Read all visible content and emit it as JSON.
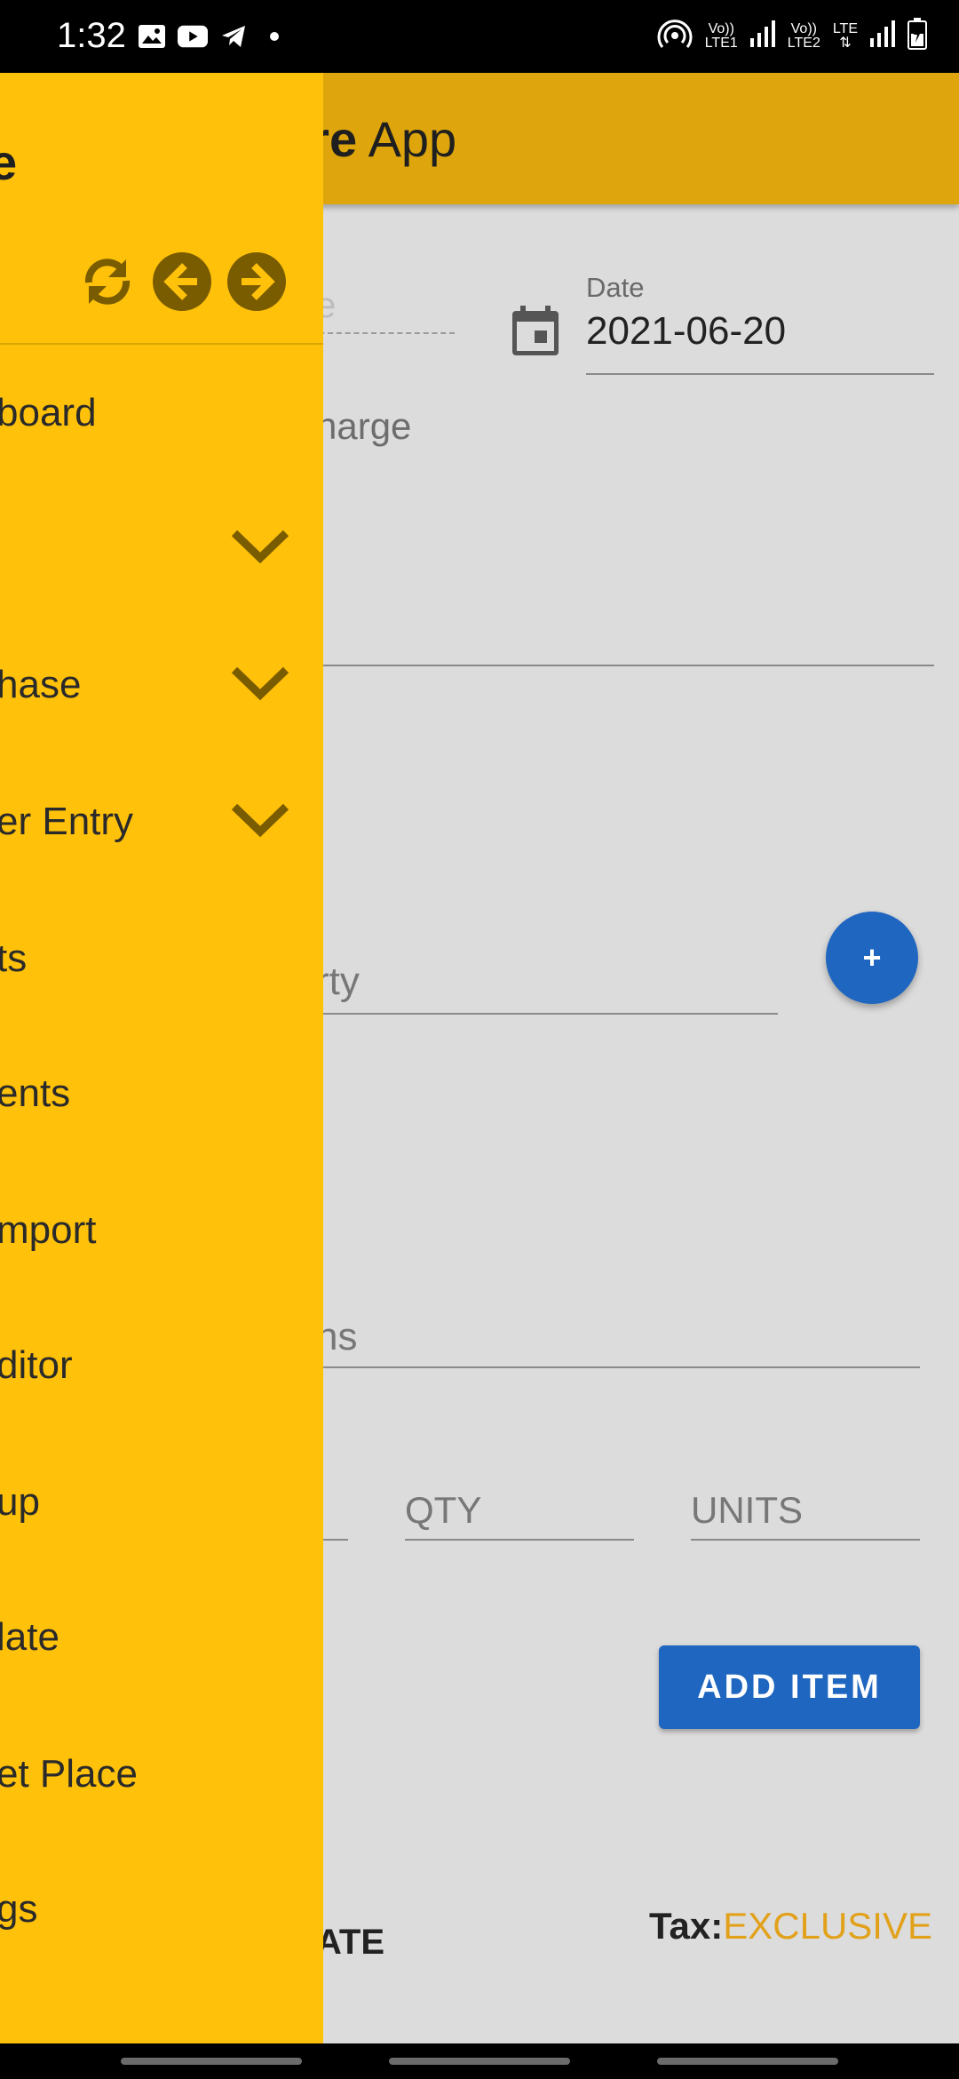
{
  "status_bar": {
    "time": "1:32",
    "left_icons": [
      "image-icon",
      "youtube-icon",
      "telegram-icon",
      "dot-icon"
    ],
    "right": {
      "sim1_top": "Vo))",
      "sim1_bottom": "LTE1",
      "sim2_top": "Vo))",
      "sim2_bottom": "LTE2",
      "lte_label": "LTE",
      "icons": [
        "hotspot-icon",
        "signal-icon",
        "battery-icon"
      ]
    }
  },
  "app_bar": {
    "title_bold": "are",
    "title_light": " App",
    "bg_color": "#dea60c"
  },
  "form": {
    "dashed_placeholder": "e",
    "date_label": "Date",
    "date_value": "2021-06-20",
    "charge_label": "harge",
    "party_placeholder": "rty",
    "fab_label": "+",
    "items_placeholder": "ns",
    "qty_placeholder": "QTY",
    "units_placeholder": "UNITS",
    "add_item_label": "ADD ITEM",
    "rate_label": "ATE",
    "tax_label": "Tax:",
    "tax_value": "EXCLUSIVE",
    "accent_color": "#1e66c0"
  },
  "drawer": {
    "header_char": "e",
    "header_icons": [
      "refresh-icon",
      "arrow-left-icon",
      "arrow-right-icon"
    ],
    "items": [
      {
        "label": "board",
        "expandable": false
      },
      {
        "label": "",
        "expandable": true
      },
      {
        "label": "hase",
        "expandable": true
      },
      {
        "label": "er Entry",
        "expandable": true
      },
      {
        "label": "ts",
        "expandable": false
      },
      {
        "label": "ents",
        "expandable": false
      },
      {
        "label": "mport",
        "expandable": false
      },
      {
        "label": "ditor",
        "expandable": false
      },
      {
        "label": "up",
        "expandable": false
      },
      {
        "label": "late",
        "expandable": false
      },
      {
        "label": "et Place",
        "expandable": false
      },
      {
        "label": "gs",
        "expandable": false
      }
    ],
    "bg_color": "#ffc10a"
  }
}
